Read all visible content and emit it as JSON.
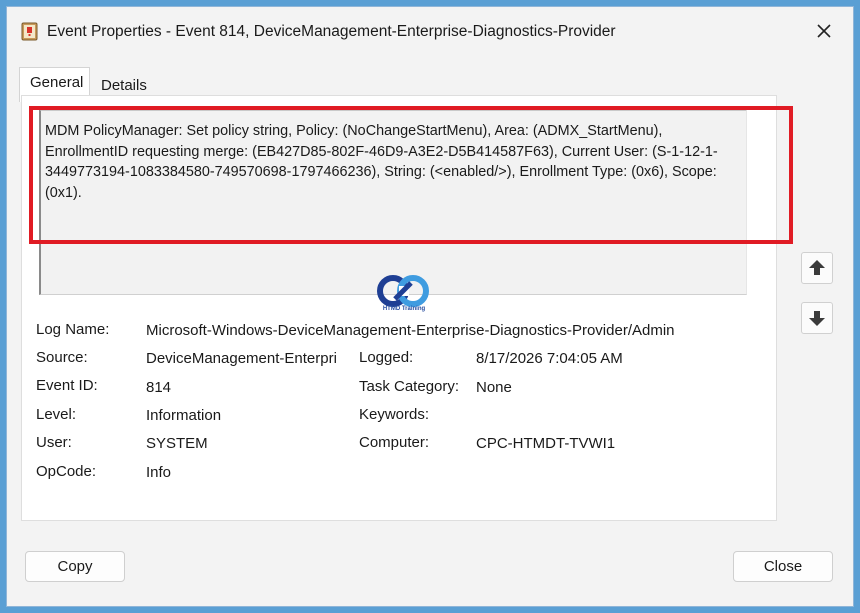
{
  "window": {
    "title": "Event Properties - Event 814, DeviceManagement-Enterprise-Diagnostics-Provider",
    "app_icon": "event-viewer-icon",
    "close_glyph": "✕"
  },
  "tabs": [
    {
      "label": "General",
      "active": true
    },
    {
      "label": "Details",
      "active": false
    }
  ],
  "description": "MDM PolicyManager: Set policy string, Policy: (NoChangeStartMenu), Area: (ADMX_StartMenu), EnrollmentID requesting merge: (EB427D85-802F-46D9-A3E2-D5B414587F63), Current User: (S-1-12-1-3449773194-1083384580-749570698-1797466236), String: (<enabled/>), Enrollment Type: (0x6), Scope: (0x1).",
  "watermark": {
    "caption": "HTMD Training",
    "icon": "htmd-logo-icon"
  },
  "fields": {
    "log_name": {
      "label": "Log Name:",
      "value": "Microsoft-Windows-DeviceManagement-Enterprise-Diagnostics-Provider/Admin"
    },
    "source": {
      "label": "Source:",
      "value": "DeviceManagement-Enterpri"
    },
    "logged": {
      "label": "Logged:",
      "value": "8/17/2026 7:04:05 AM"
    },
    "event_id": {
      "label": "Event ID:",
      "value": "814"
    },
    "task_category": {
      "label": "Task Category:",
      "value": "None"
    },
    "level": {
      "label": "Level:",
      "value": "Information"
    },
    "keywords": {
      "label": "Keywords:",
      "value": ""
    },
    "user": {
      "label": "User:",
      "value": "SYSTEM"
    },
    "computer": {
      "label": "Computer:",
      "value": "CPC-HTMDT-TVWI1"
    },
    "opcode": {
      "label": "OpCode:",
      "value": "Info"
    }
  },
  "nav": {
    "up_icon": "arrow-up-icon",
    "down_icon": "arrow-down-icon"
  },
  "buttons": {
    "copy": "Copy",
    "close": "Close"
  },
  "colors": {
    "highlight": "#e01b24",
    "background": "#5a9fd4"
  }
}
